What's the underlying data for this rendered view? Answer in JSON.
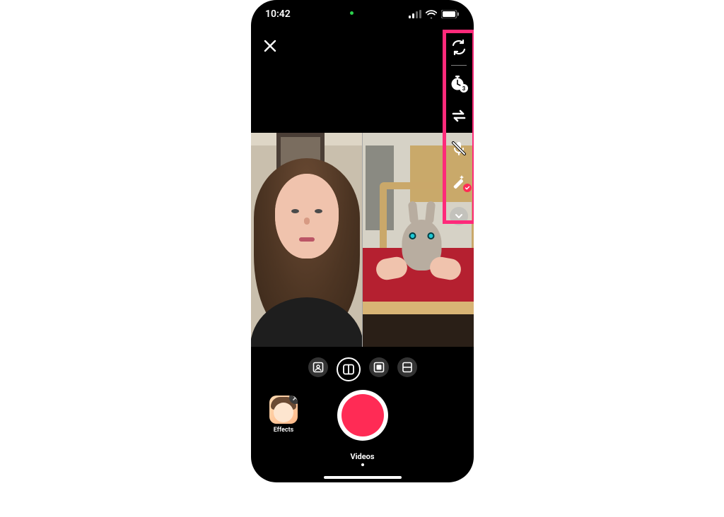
{
  "status_bar": {
    "time": "10:42",
    "location_dot": true,
    "signal_bars": 3,
    "wifi": true,
    "battery_pct": 90
  },
  "colors": {
    "highlight": "#ff2a7a",
    "record": "#ff2b55"
  },
  "close_label": "Close",
  "right_toolbar": {
    "items": [
      {
        "name": "flip-camera-icon"
      },
      {
        "name": "timer-icon",
        "badge": "3"
      },
      {
        "name": "swap-layout-icon"
      },
      {
        "name": "mic-off-icon"
      },
      {
        "name": "beautify-icon",
        "checked": true
      }
    ],
    "expand_label": "More"
  },
  "layout_options": [
    {
      "name": "layout-green-screen"
    },
    {
      "name": "layout-side-by-side",
      "selected": true
    },
    {
      "name": "layout-picture-in-picture"
    },
    {
      "name": "layout-top-bottom"
    }
  ],
  "effects": {
    "label": "Effects"
  },
  "record_label": "Record",
  "mode": {
    "label": "Videos"
  },
  "viewfinder": {
    "left_description": "Front camera selfie of a person with long curly brown hair in a room with a dark door behind them",
    "right_description": "Duet source video of hands holding a small gray rabbit with blue-tinted eyes on a red cushion, wooden chair and kitchen cabinets behind"
  }
}
